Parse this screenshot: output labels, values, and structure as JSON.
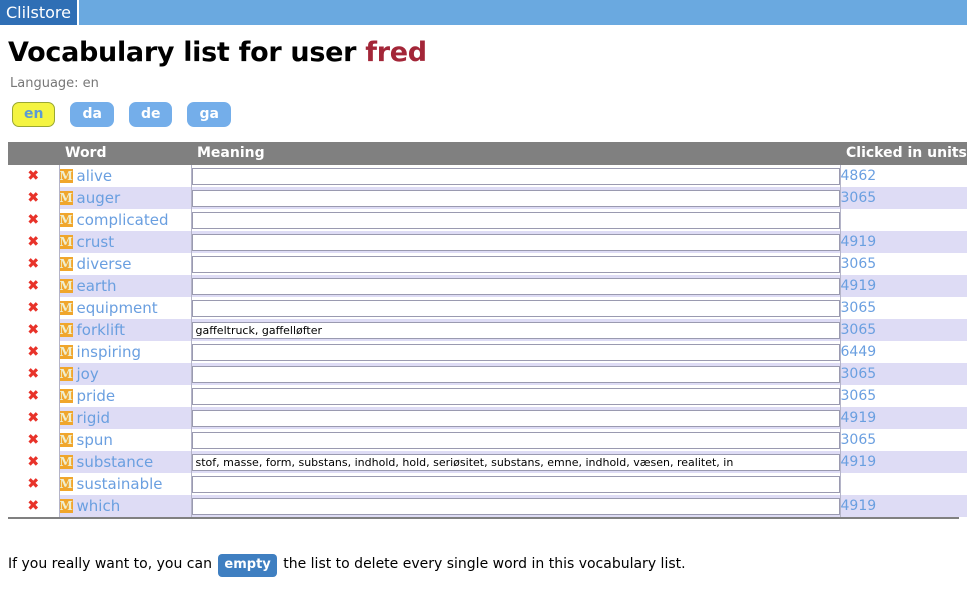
{
  "topbar": {
    "brand": "Clilstore"
  },
  "header": {
    "title_prefix": "Vocabulary list for user ",
    "user": "fred",
    "language_line": "Language: en"
  },
  "language_pills": [
    {
      "code": "en",
      "active": true
    },
    {
      "code": "da",
      "active": false
    },
    {
      "code": "de",
      "active": false
    },
    {
      "code": "ga",
      "active": false
    }
  ],
  "table": {
    "columns": {
      "delete": "",
      "word": "Word",
      "meaning": "Meaning",
      "units": "Clicked in units"
    },
    "delete_icon": "✖",
    "word_icon": "M",
    "meaning_placeholder": "",
    "rows": [
      {
        "word": "alive",
        "meaning": "",
        "units": "4862"
      },
      {
        "word": "auger",
        "meaning": "",
        "units": "3065"
      },
      {
        "word": "complicated",
        "meaning": "",
        "units": ""
      },
      {
        "word": "crust",
        "meaning": "",
        "units": "4919"
      },
      {
        "word": "diverse",
        "meaning": "",
        "units": "3065"
      },
      {
        "word": "earth",
        "meaning": "",
        "units": "4919"
      },
      {
        "word": "equipment",
        "meaning": "",
        "units": "3065"
      },
      {
        "word": "forklift",
        "meaning": "gaffeltruck, gaffelløfter",
        "units": "3065"
      },
      {
        "word": "inspiring",
        "meaning": "",
        "units": "6449"
      },
      {
        "word": "joy",
        "meaning": "",
        "units": "3065"
      },
      {
        "word": "pride",
        "meaning": "",
        "units": "3065"
      },
      {
        "word": "rigid",
        "meaning": "",
        "units": "4919"
      },
      {
        "word": "spun",
        "meaning": "",
        "units": "3065"
      },
      {
        "word": "substance",
        "meaning": "stof, masse, form, substans, indhold, hold, seriøsitet, substans, emne, indhold, væsen, realitet, in",
        "units": "4919"
      },
      {
        "word": "sustainable",
        "meaning": "",
        "units": ""
      },
      {
        "word": "which",
        "meaning": "",
        "units": "4919"
      }
    ]
  },
  "footer": {
    "text_before": "If you really want to, you can",
    "empty_label": "empty",
    "text_after": "the list to delete every single word in this vocabulary list."
  },
  "colors": {
    "topbar_bg": "#6aa9e0",
    "brand_bg": "#2f6fb5",
    "accent_blue": "#6a9fe0",
    "user_red": "#a32638",
    "header_gray": "#808080",
    "row_stripe": "#dedcf5",
    "pill_active_bg": "#f4f441",
    "delete_red": "#e8332a",
    "badge_orange": "#f0a62c"
  }
}
